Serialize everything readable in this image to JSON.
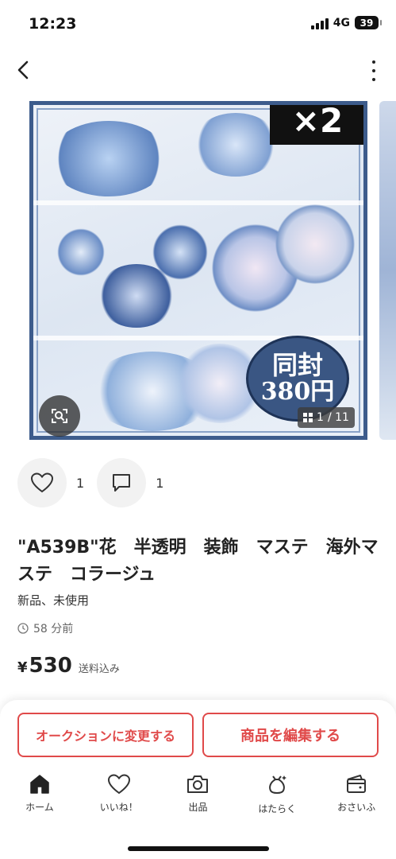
{
  "status": {
    "time": "12:23",
    "network": "4G",
    "battery": "39"
  },
  "colors": {
    "accent": "#e04a4a",
    "frame": "#3d5c8c",
    "text": "#222222"
  },
  "carousel": {
    "quantity_badge": "×2",
    "bundle_line1": "同封",
    "bundle_line2": "380円",
    "page_current": "1",
    "page_total": "/ 11"
  },
  "social": {
    "likes": "1",
    "comments": "1"
  },
  "product": {
    "title": "\"A539B\"花　半透明　装飾　マステ　海外マステ　コラージュ",
    "condition": "新品、未使用",
    "posted": "58 分前",
    "currency": "¥",
    "price": "530",
    "shipping": "送料込み"
  },
  "actions": {
    "auction": "オークションに変更する",
    "edit": "商品を編集する"
  },
  "tabs": [
    {
      "label": "ホーム",
      "icon": "home-icon"
    },
    {
      "label": "いいね！",
      "icon": "heart-icon"
    },
    {
      "label": "出品",
      "icon": "camera-icon"
    },
    {
      "label": "はたらく",
      "icon": "bag-icon"
    },
    {
      "label": "おさいふ",
      "icon": "wallet-icon"
    }
  ]
}
